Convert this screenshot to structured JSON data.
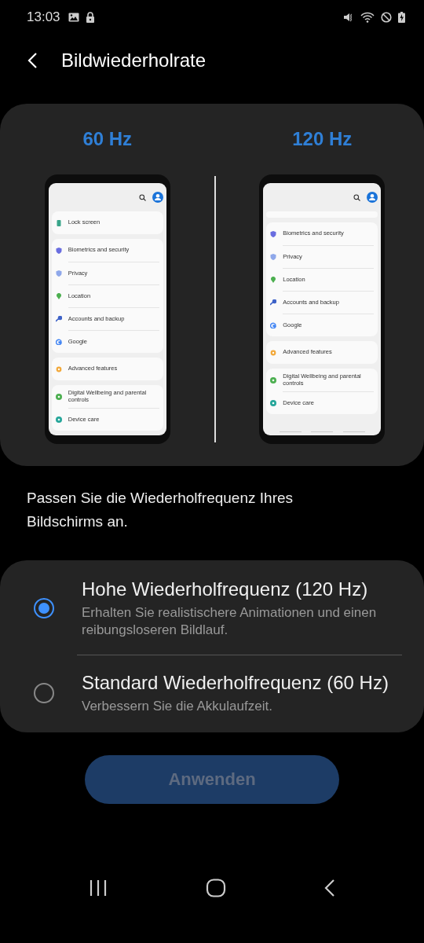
{
  "status_bar": {
    "time": "13:03"
  },
  "header": {
    "title": "Bildwiederholrate"
  },
  "previews": [
    {
      "label": "60 Hz",
      "scrolled": false,
      "groups": [
        [
          {
            "label": "Lock screen",
            "kind": "lock",
            "color": "#3aa58a"
          }
        ],
        [
          {
            "label": "Biometrics and security",
            "kind": "shield",
            "color": "#6a6ee0"
          },
          {
            "label": "Privacy",
            "kind": "shield",
            "color": "#8fa8ea"
          },
          {
            "label": "Location",
            "kind": "pin",
            "color": "#4caf50"
          },
          {
            "label": "Accounts and backup",
            "kind": "key",
            "color": "#3f63c8"
          },
          {
            "label": "Google",
            "kind": "letter",
            "color": "#4285f4"
          }
        ],
        [
          {
            "label": "Advanced features",
            "kind": "gear",
            "color": "#f2a93b"
          }
        ],
        [
          {
            "label": "Digital Wellbeing and parental controls",
            "kind": "ring",
            "color": "#4caf50"
          },
          {
            "label": "Device care",
            "kind": "ring",
            "color": "#26a69a"
          }
        ]
      ]
    },
    {
      "label": "120 Hz",
      "scrolled": true,
      "groups": [
        [
          {
            "label": "Biometrics and security",
            "kind": "shield",
            "color": "#6a6ee0"
          },
          {
            "label": "Privacy",
            "kind": "shield",
            "color": "#8fa8ea"
          },
          {
            "label": "Location",
            "kind": "pin",
            "color": "#4caf50"
          },
          {
            "label": "Accounts and backup",
            "kind": "key",
            "color": "#3f63c8"
          },
          {
            "label": "Google",
            "kind": "letter",
            "color": "#4285f4"
          }
        ],
        [
          {
            "label": "Advanced features",
            "kind": "gear",
            "color": "#f2a93b"
          }
        ],
        [
          {
            "label": "Digital Wellbeing and parental controls",
            "kind": "ring",
            "color": "#4caf50"
          },
          {
            "label": "Device care",
            "kind": "ring",
            "color": "#26a69a"
          }
        ]
      ]
    }
  ],
  "description": "Passen Sie die Wiederholfrequenz Ihres Bildschirms an.",
  "options": [
    {
      "title": "Hohe Wiederholfrequenz (120 Hz)",
      "subtitle": "Erhalten Sie realistischere Animationen und einen reibungsloseren Bildlauf.",
      "selected": true
    },
    {
      "title": "Standard Wiederholfrequenz (60 Hz)",
      "subtitle": "Verbessern Sie die Akkulaufzeit.",
      "selected": false
    }
  ],
  "apply_button": {
    "label": "Anwenden",
    "disabled": true
  }
}
